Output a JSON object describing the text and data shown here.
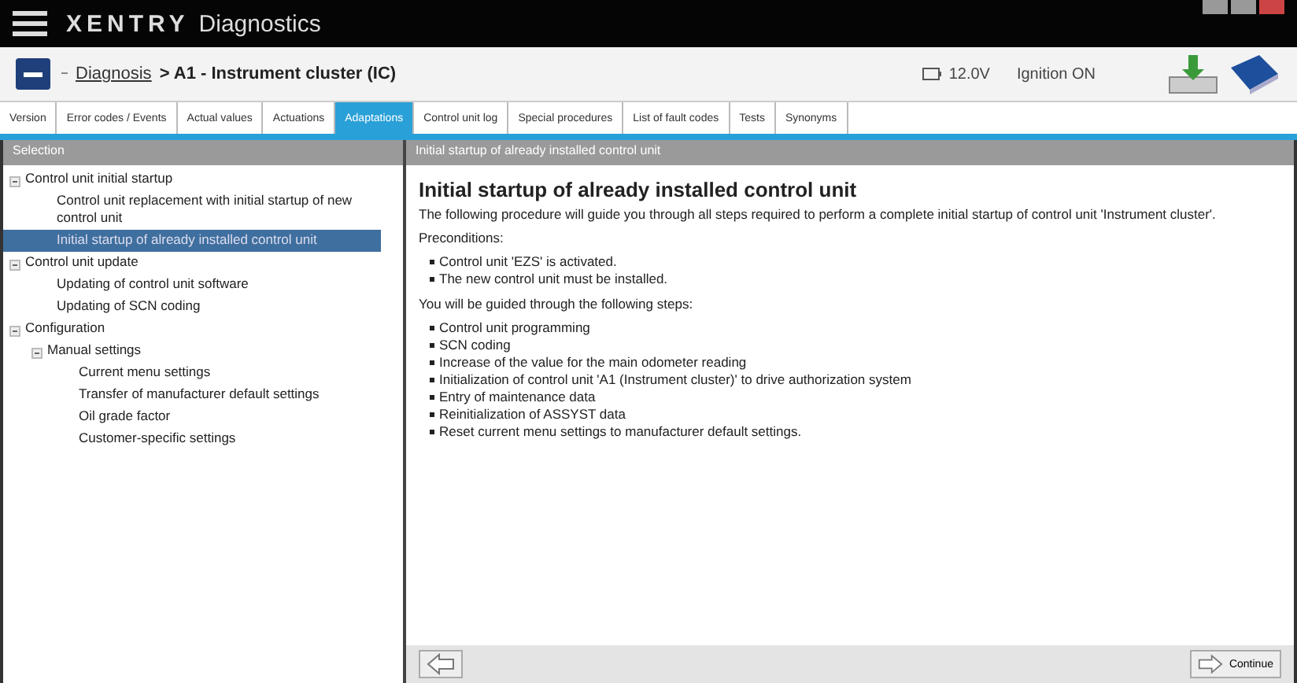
{
  "app": {
    "brand": "XENTRY",
    "product": "Diagnostics"
  },
  "header": {
    "breadcrumb_link": "Diagnosis",
    "breadcrumb_rest": "> A1 - Instrument cluster (IC)",
    "voltage": "12.0V",
    "ignition": "Ignition ON"
  },
  "tabs": [
    {
      "label": "Version",
      "selected": false
    },
    {
      "label": "Error codes / Events",
      "selected": false
    },
    {
      "label": "Actual values",
      "selected": false
    },
    {
      "label": "Actuations",
      "selected": false
    },
    {
      "label": "Adaptations",
      "selected": true
    },
    {
      "label": "Control unit log",
      "selected": false
    },
    {
      "label": "Special procedures",
      "selected": false
    },
    {
      "label": "List of fault codes",
      "selected": false
    },
    {
      "label": "Tests",
      "selected": false
    },
    {
      "label": "Synonyms",
      "selected": false
    }
  ],
  "sidebar": {
    "title": "Selection",
    "items": [
      {
        "label": "Control unit initial startup",
        "expanded": true,
        "selected": false,
        "children": [
          {
            "label": "Control unit replacement with initial startup of new control unit",
            "selected": false
          },
          {
            "label": "Initial startup of already installed control unit",
            "selected": true
          }
        ]
      },
      {
        "label": "Control unit update",
        "expanded": true,
        "selected": false,
        "children": [
          {
            "label": "Updating of control unit software",
            "selected": false
          },
          {
            "label": "Updating of SCN coding",
            "selected": false
          }
        ]
      },
      {
        "label": "Configuration",
        "expanded": true,
        "selected": false,
        "children": [
          {
            "label": "Manual settings",
            "expanded": true,
            "selected": false,
            "children": [
              {
                "label": "Current menu settings",
                "selected": false
              },
              {
                "label": "Transfer of manufacturer default settings",
                "selected": false
              },
              {
                "label": "Oil grade factor",
                "selected": false
              },
              {
                "label": "Customer-specific settings",
                "selected": false
              }
            ]
          }
        ]
      }
    ]
  },
  "content": {
    "panel_title": "Initial startup of already installed control unit",
    "heading": "Initial startup of already installed control unit",
    "intro": "The following procedure will guide you through all steps required to perform a complete initial startup of control unit 'Instrument cluster'.",
    "preconditions_label": "Preconditions:",
    "preconditions": [
      "Control unit 'EZS' is activated.",
      "The new control unit must be installed."
    ],
    "steps_label": "You will be guided through the following steps:",
    "steps": [
      "Control unit programming",
      "SCN coding",
      "Increase of the value for the main odometer reading",
      "Initialization of control unit 'A1 (Instrument cluster)' to drive authorization system",
      "Entry of maintenance data",
      "Reinitialization of ASSYST data",
      "Reset current menu settings to manufacturer default settings."
    ]
  },
  "footer": {
    "continue": "Continue"
  }
}
